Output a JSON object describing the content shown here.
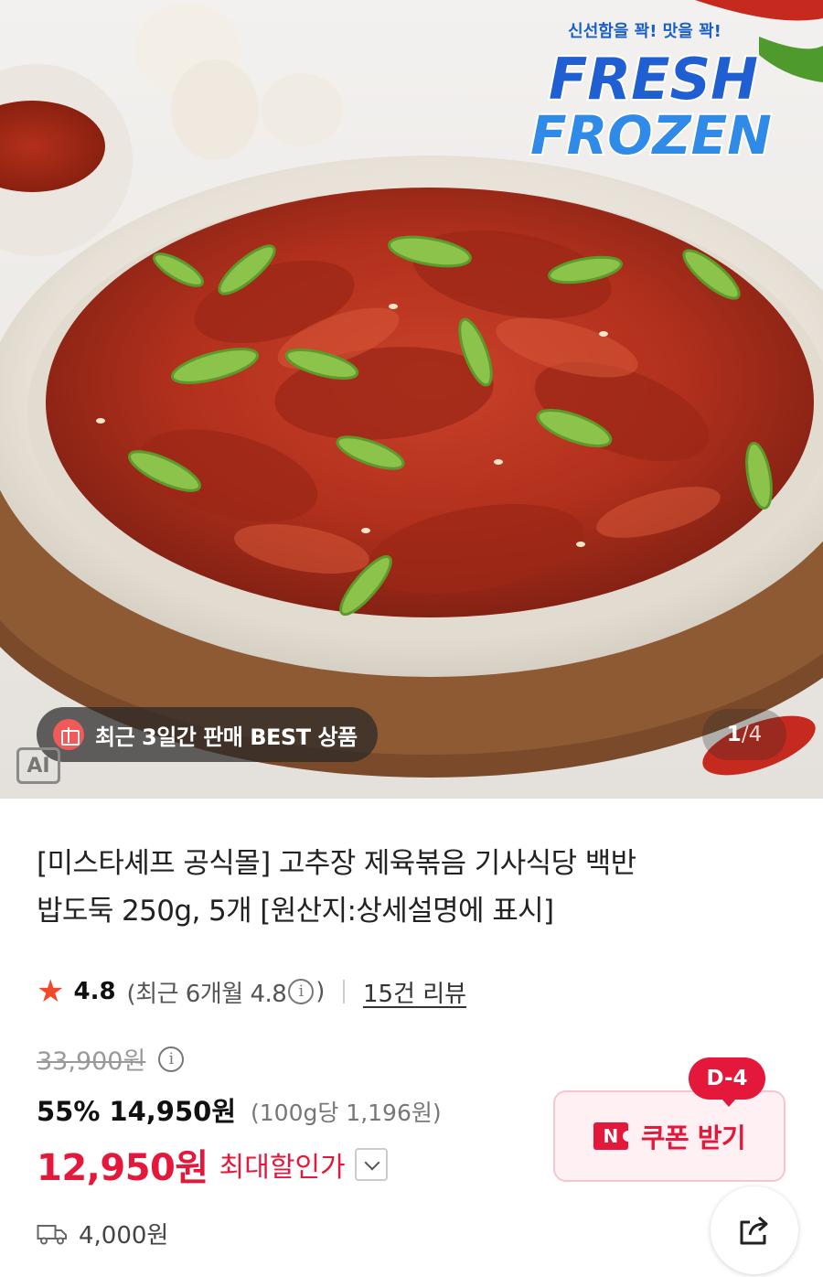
{
  "hero": {
    "logo_top": "FRESH",
    "logo_bottom": "FROZEN",
    "logo_tagline": "신선함을 꽉! 맛을 꽉!",
    "best_badge": "최근 3일간 판매 BEST 상품",
    "pager_current": "1",
    "pager_separator": "/",
    "pager_total": "4",
    "ai_label": "AI"
  },
  "product": {
    "title_line1": "[미스타셰프 공식몰] 고추장 제육볶음 기사식당 백반",
    "title_line2": "밥도둑 250g, 5개 [원산지:상세설명에 표시]"
  },
  "rating": {
    "star_icon": "★",
    "score": "4.8",
    "recent_prefix": "(최근 6개월 4.8",
    "info_icon": "i",
    "recent_suffix": ")",
    "reviews": "15건 리뷰"
  },
  "price": {
    "original": "33,900원",
    "info_icon": "i",
    "discount_pct": "55%",
    "sale_price": "14,950원",
    "unit_price": "(100g당 1,196원)",
    "max_price": "12,950원",
    "max_label": "최대할인가"
  },
  "coupon": {
    "dday": "D-4",
    "logo": "N",
    "label": "쿠폰 받기"
  },
  "shipping": {
    "fee": "4,000원"
  },
  "colors": {
    "accent_red": "#e4183a",
    "star": "#f04a2a",
    "coupon_bg": "#fff1f3"
  }
}
